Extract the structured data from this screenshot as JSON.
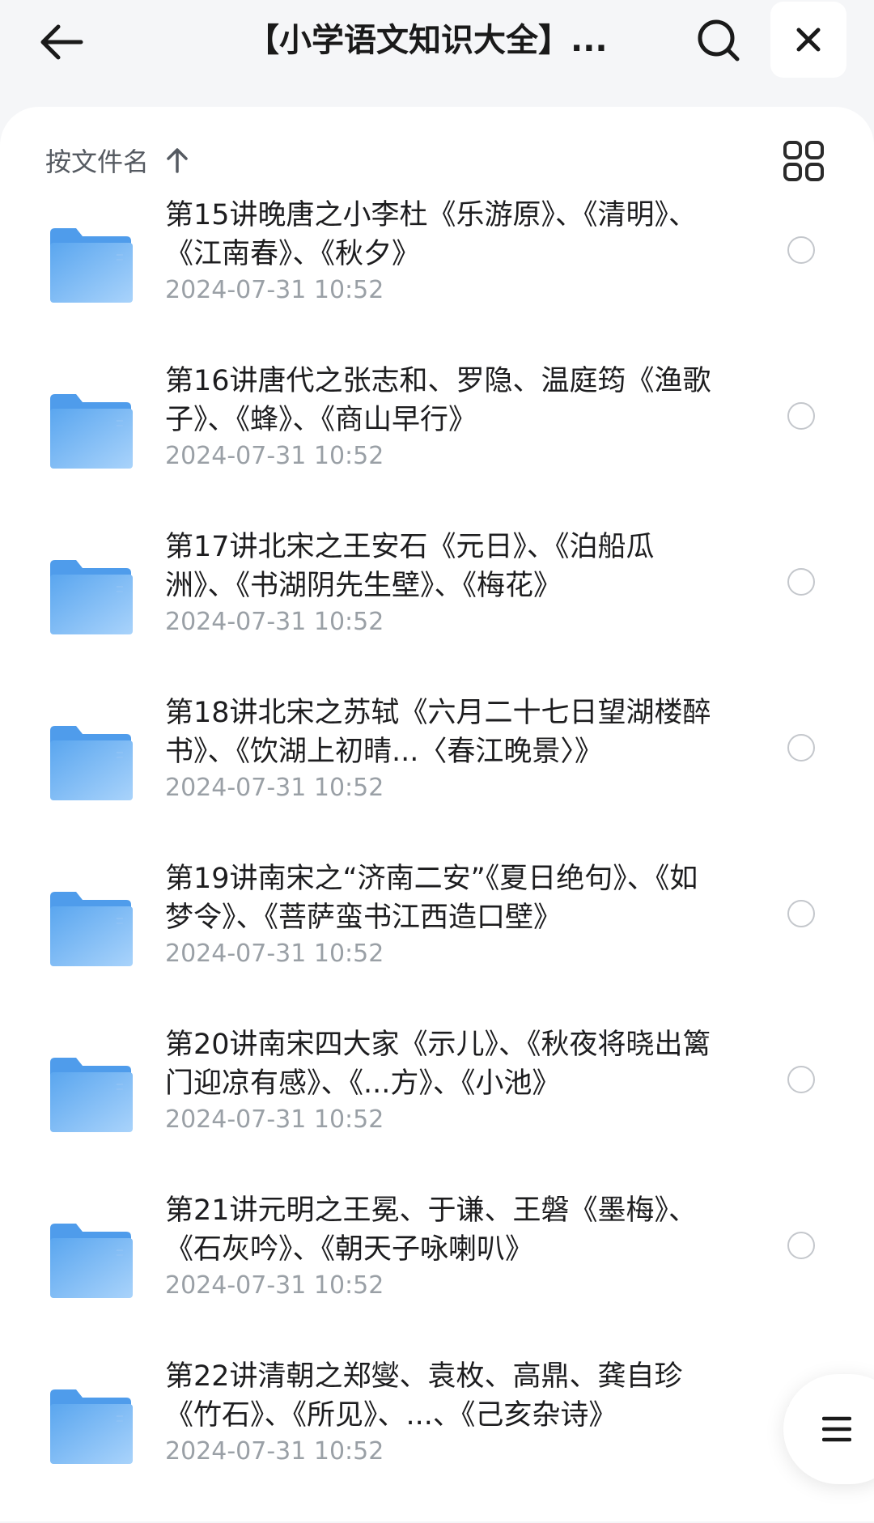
{
  "header": {
    "title": "【小学语文知识大全】..."
  },
  "sort": {
    "label": "按文件名"
  },
  "colors": {
    "folder": "#6db3f2",
    "date": "#9aa0a6",
    "accent": "#1d1d1f"
  },
  "files": [
    {
      "name": "第15讲晚唐之小李杜《乐游原》、《清明》、《江南春》、《秋夕》",
      "date": "2024-07-31 10:52"
    },
    {
      "name": "第16讲唐代之张志和、罗隐、温庭筠《渔歌子》、《蜂》、《商山早行》",
      "date": "2024-07-31 10:52"
    },
    {
      "name": "第17讲北宋之王安石《元日》、《泊船瓜洲》、《书湖阴先生壁》、《梅花》",
      "date": "2024-07-31 10:52"
    },
    {
      "name": "第18讲北宋之苏轼《六月二十七日望湖楼醉书》、《饮湖上初晴...〈春江晚景〉》",
      "date": "2024-07-31 10:52"
    },
    {
      "name": "第19讲南宋之“济南二安”《夏日绝句》、《如梦令》、《菩萨蛮书江西造口壁》",
      "date": "2024-07-31 10:52"
    },
    {
      "name": "第20讲南宋四大家《示儿》、《秋夜将晓出篱门迎凉有感》、《...方》、《小池》",
      "date": "2024-07-31 10:52"
    },
    {
      "name": "第21讲元明之王冕、于谦、王磐《墨梅》、《石灰吟》、《朝天子咏喇叭》",
      "date": "2024-07-31 10:52"
    },
    {
      "name": "第22讲清朝之郑燮、袁枚、高鼎、龚自珍《竹石》、《所见》、...、《己亥杂诗》",
      "date": "2024-07-31 10:52"
    }
  ]
}
